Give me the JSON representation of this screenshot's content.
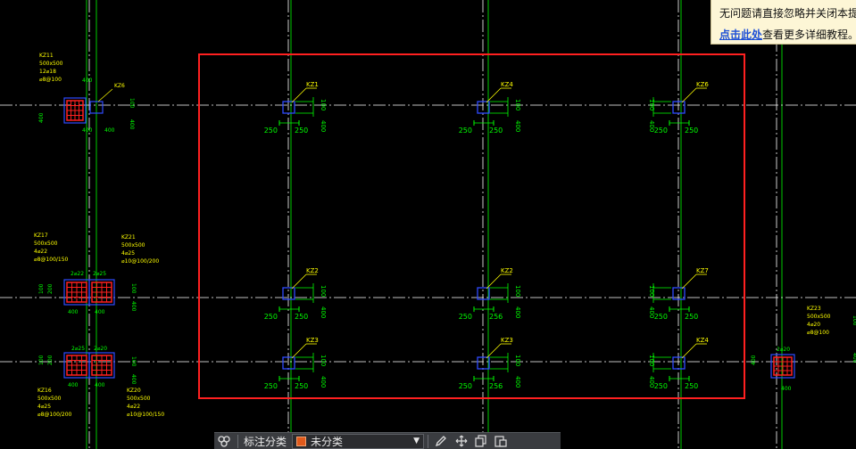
{
  "tip": {
    "line1": "无问题请直接忽略并关闭本提示",
    "link": "点击此处",
    "line2_rest": "查看更多详细教程。"
  },
  "toolbar": {
    "label": "标注分类",
    "selected_category": "未分类",
    "icons": [
      "layers-icon",
      "edit-icon",
      "move-icon",
      "copy-icon",
      "paste-icon"
    ]
  },
  "drawing": {
    "colors": {
      "background": "#000000",
      "axis": "#ffffff",
      "dim": "#00ff00",
      "column": "#2f4bff",
      "selection": "#ff2020",
      "text": "#ffff00",
      "rebar": "#ff2020"
    },
    "main_labels": {
      "r1": [
        "KZ1",
        "KZ4",
        "KZ6"
      ],
      "r2": [
        "KZ2",
        "KZ2",
        "KZ7"
      ],
      "r3": [
        "KZ3",
        "KZ3",
        "KZ4"
      ]
    },
    "dims": {
      "a": "250",
      "b": "250",
      "b2": "256",
      "c": "400",
      "d": "100"
    },
    "left_labels": {
      "kz11": [
        "KZ11",
        "500x500",
        "12⌀18",
        "⌀8@100"
      ],
      "kz6": "KZ6",
      "kz17": [
        "KZ17",
        "500x500",
        "4⌀22",
        "⌀8@100/150"
      ],
      "kz21": [
        "KZ21",
        "500x500",
        "4⌀25",
        "⌀10@100/200"
      ],
      "kz16": [
        "KZ16",
        "500x500",
        "4⌀25",
        "⌀8@100/200"
      ],
      "kz20": [
        "KZ20",
        "500x500",
        "4⌀22",
        "⌀10@100/150"
      ],
      "kz23": [
        "KZ23",
        "500x500",
        "4⌀20",
        "⌀8@100"
      ],
      "top_dims": [
        "2⌀22",
        "2⌀25",
        "2⌀25",
        "2⌀20",
        "2⌀20"
      ]
    }
  }
}
